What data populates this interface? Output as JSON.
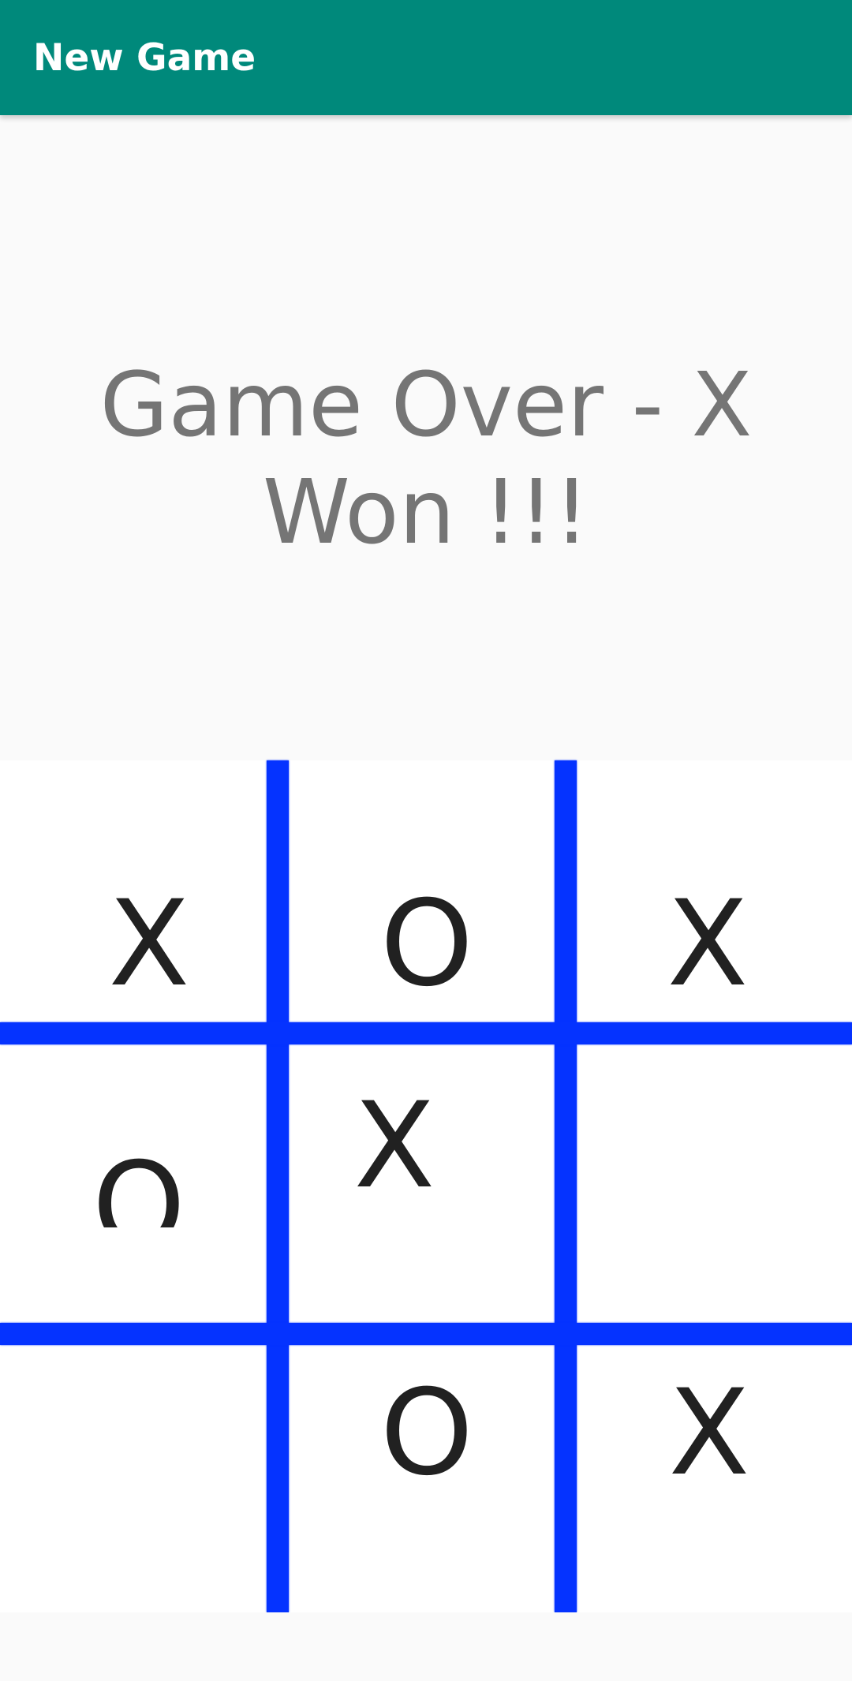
{
  "app_bar": {
    "title": "New Game",
    "background_color": "#00897b"
  },
  "status": {
    "message": "Game Over  - X\nWon !!!"
  },
  "board": {
    "line_color": "#0533ff",
    "cells": [
      [
        "X",
        "O",
        "X"
      ],
      [
        "O",
        "X",
        ""
      ],
      [
        "",
        "O",
        "X"
      ]
    ]
  }
}
